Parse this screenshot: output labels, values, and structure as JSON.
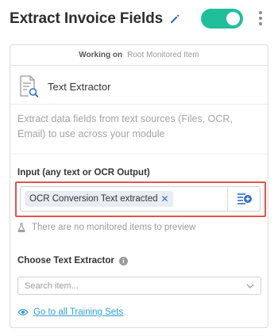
{
  "header": {
    "title": "Extract Invoice Fields",
    "toggle_on": true,
    "toggle_color": "#1fbf9c"
  },
  "working_on": {
    "label": "Working on",
    "value": "Root Monitored Item"
  },
  "extractor": {
    "icon": "document-search-icon",
    "name": "Text Extractor",
    "description": "Extract data fields from text sources (Files, OCR, Email) to use across your module"
  },
  "input": {
    "label": "Input (any text or OCR Output)",
    "chips": [
      "OCR Conversion Text extracted"
    ],
    "highlight_color": "#e0554a",
    "empty_message": "There are no monitored items to preview"
  },
  "choose": {
    "label": "Choose Text Extractor",
    "placeholder": "Search item..."
  },
  "link": {
    "label": "Go to all Training Sets",
    "color": "#2f9fd8"
  }
}
